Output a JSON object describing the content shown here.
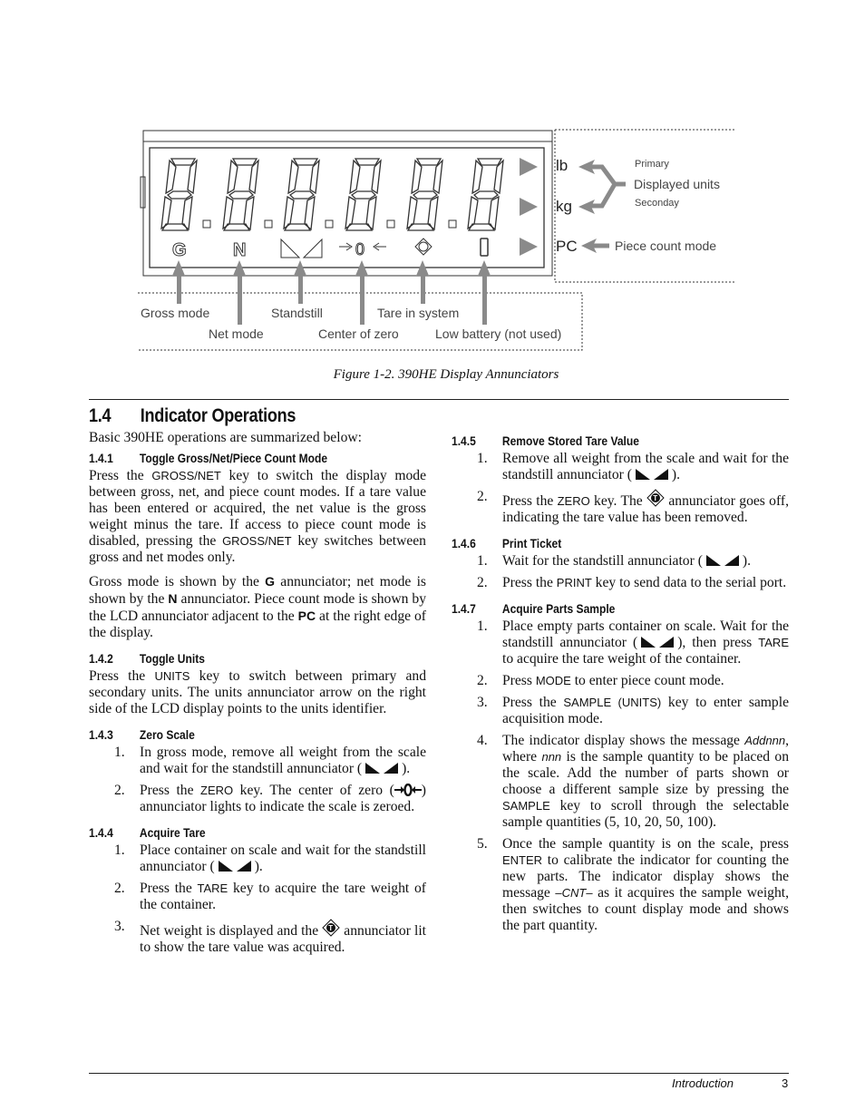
{
  "figure": {
    "unit_labels": [
      "lb",
      "kg",
      "PC"
    ],
    "unit_callouts": {
      "primary": "Primary",
      "displayed_units": "Displayed units",
      "secondary": "Seconday",
      "piece_count": "Piece count mode"
    },
    "annunciator_labels": {
      "gross": "Gross mode",
      "net": "Net mode",
      "standstill": "Standstill",
      "center_zero": "Center of zero",
      "tare": "Tare in system",
      "battery": "Low battery (not used)"
    },
    "annunciator_glyphs": {
      "gross": "G",
      "net": "N",
      "zero": "0",
      "tare": "T"
    },
    "caption": "Figure 1-2. 390HE Display Annunciators"
  },
  "section": {
    "number": "1.4",
    "title": "Indicator Operations",
    "intro": "Basic 390HE operations are summarized below:"
  },
  "s141": {
    "number": "1.4.1",
    "title": "Toggle Gross/Net/Piece Count Mode",
    "p1_a": "Press the ",
    "p1_key": "GROSS/NET",
    "p1_b": " key to switch the display mode between gross, net, and piece count modes. If a tare value has been entered or acquired, the net value is the gross weight minus the tare. If access to piece count mode is disabled, pressing the ",
    "p1_key2": "GROSS/NET",
    "p1_c": " key switches between gross and net modes only.",
    "p2_a": "Gross mode is shown by the ",
    "p2_g": "G",
    "p2_b": " annunciator; net mode is shown by the ",
    "p2_n": "N",
    "p2_c": " annunciator. Piece count mode is shown by the LCD annunciator adjacent to the ",
    "p2_pc": "PC",
    "p2_d": " at the right edge of the display."
  },
  "s142": {
    "number": "1.4.2",
    "title": "Toggle Units",
    "p_a": "Press the ",
    "p_key": "UNITS",
    "p_b": " key to switch between primary and secondary units. The units annunciator arrow on the right side of the LCD display points to the units identifier."
  },
  "s143": {
    "number": "1.4.3",
    "title": "Zero Scale",
    "i1_n": "1.",
    "i1_a": "In gross mode, remove all weight from the scale and wait for the standstill annunciator (",
    "i1_b": ").",
    "i2_n": "2.",
    "i2_a": "Press the ",
    "i2_key": "ZERO",
    "i2_b": " key. The center of zero (",
    "i2_c": ") annunciator lights to indicate the scale is zeroed."
  },
  "s144": {
    "number": "1.4.4",
    "title": "Acquire Tare",
    "i1_n": "1.",
    "i1_a": "Place container on scale and wait for the standstill annunciator (",
    "i1_b": ").",
    "i2_n": "2.",
    "i2_a": "Press the ",
    "i2_key": "TARE",
    "i2_b": " key to acquire the tare weight of the container.",
    "i3_n": "3.",
    "i3_a": "Net weight is displayed and the ",
    "i3_b": " annunciator lit to show the tare value was acquired."
  },
  "s145": {
    "number": "1.4.5",
    "title": "Remove Stored Tare Value",
    "i1_n": "1.",
    "i1_a": "Remove all weight from the scale and wait for the standstill annunciator (",
    "i1_b": ").",
    "i2_n": "2.",
    "i2_a": "Press the ",
    "i2_key": "ZERO",
    "i2_b": " key. The ",
    "i2_c": " annunciator goes off, indicating the tare value has been removed."
  },
  "s146": {
    "number": "1.4.6",
    "title": "Print Ticket",
    "i1_n": "1.",
    "i1_a": "Wait for the standstill annunciator (",
    "i1_b": ").",
    "i2_n": "2.",
    "i2_a": "Press the ",
    "i2_key": "PRINT",
    "i2_b": " key to send data to the serial port."
  },
  "s147": {
    "number": "1.4.7",
    "title": "Acquire Parts Sample",
    "i1_n": "1.",
    "i1_a": "Place empty parts container on scale. Wait for the standstill annunciator (",
    "i1_b": "), then press ",
    "i1_key": "TARE",
    "i1_c": " to acquire the tare weight of the container.",
    "i2_n": "2.",
    "i2_a": "Press ",
    "i2_key": "MODE",
    "i2_b": " to enter piece count mode.",
    "i3_n": "3.",
    "i3_a": "Press the ",
    "i3_key": "SAMPLE",
    "i3_p1": " (",
    "i3_key2": "UNITS",
    "i3_p2": ")",
    "i3_b": " key to enter sample acquisition mode.",
    "i4_n": "4.",
    "i4_a": "The indicator display shows the message ",
    "i4_msg": "Addnnn",
    "i4_b": ", where ",
    "i4_nnn": "nnn",
    "i4_c": " is the sample quantity to be placed on the scale. Add the number of parts shown or choose a different sample size by pressing the ",
    "i4_key": "SAMPLE",
    "i4_d": " key to scroll through the selectable sample quantities (5, 10, 20, 50, 100).",
    "i5_n": "5.",
    "i5_a": "Once the sample quantity is on the scale, press ",
    "i5_key": "ENTER",
    "i5_b": " to calibrate the indicator for counting the new parts. The indicator display shows the message ",
    "i5_msg": "–CNT–",
    "i5_c": " as it acquires the sample weight, then switches to count display mode and shows the part quantity."
  },
  "footer": {
    "section": "Introduction",
    "page": "3"
  },
  "colors": {
    "arrow_gray": "#8a8a8a",
    "lcd_line": "#333333",
    "text": "#111111"
  }
}
